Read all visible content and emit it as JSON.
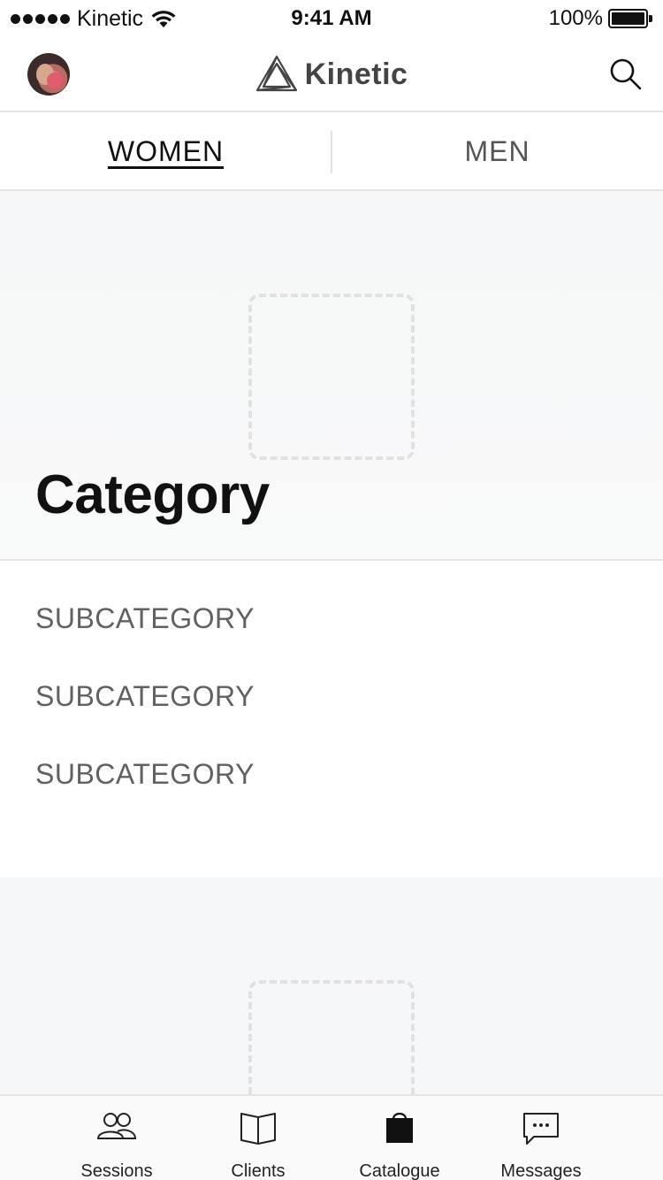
{
  "status_bar": {
    "carrier": "Kinetic",
    "time": "9:41 AM",
    "battery_percent": "100%",
    "battery_level": 1.0
  },
  "nav": {
    "brand": "Kinetic",
    "search_icon": "search-icon",
    "logo_icon": "penrose-triangle-logo"
  },
  "tabs": [
    {
      "label": "WOMEN",
      "active": true
    },
    {
      "label": "MEN",
      "active": false
    }
  ],
  "hero": {
    "title": "Category"
  },
  "subcategories": [
    {
      "label": "SUBCATEGORY"
    },
    {
      "label": "SUBCATEGORY"
    },
    {
      "label": "SUBCATEGORY"
    }
  ],
  "tabbar": [
    {
      "label": "Sessions",
      "icon": "people-icon"
    },
    {
      "label": "Clients",
      "icon": "book-icon"
    },
    {
      "label": "Catalogue",
      "icon": "bag-icon"
    },
    {
      "label": "Messages",
      "icon": "chat-icon"
    }
  ],
  "colors": {
    "text": "#111111",
    "muted": "#616161",
    "divider": "#e4e4e4",
    "placeholder_bg": "#f6f7f8"
  }
}
